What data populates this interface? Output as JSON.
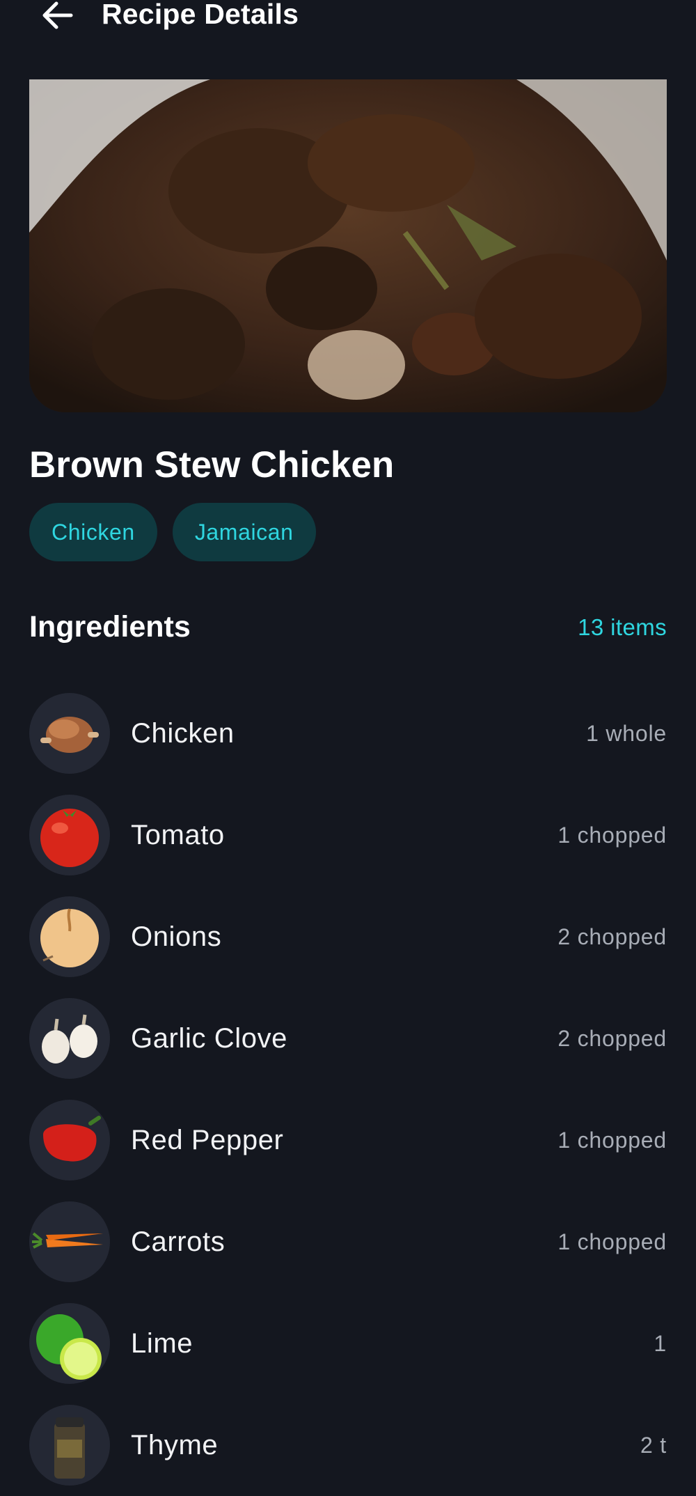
{
  "header": {
    "title": "Recipe Details",
    "back_icon": "arrow-left-icon"
  },
  "recipe": {
    "title": "Brown Stew Chicken",
    "tags": [
      "Chicken",
      "Jamaican"
    ]
  },
  "ingredients": {
    "title": "Ingredients",
    "count": "13 items",
    "items": [
      {
        "name": "Chicken",
        "qty": "1 whole",
        "icon": "roast-chicken-icon"
      },
      {
        "name": "Tomato",
        "qty": "1 chopped",
        "icon": "tomato-icon"
      },
      {
        "name": "Onions",
        "qty": "2 chopped",
        "icon": "onion-icon"
      },
      {
        "name": "Garlic Clove",
        "qty": "2 chopped",
        "icon": "garlic-icon"
      },
      {
        "name": "Red Pepper",
        "qty": "1 chopped",
        "icon": "red-pepper-icon"
      },
      {
        "name": "Carrots",
        "qty": "1 chopped",
        "icon": "carrot-icon"
      },
      {
        "name": "Lime",
        "qty": "1",
        "icon": "lime-icon"
      },
      {
        "name": "Thyme",
        "qty": "2 t",
        "icon": "thyme-jar-icon"
      }
    ]
  },
  "colors": {
    "background": "#14171f",
    "accent": "#2fd6e0",
    "tag_bg": "#0f3a40"
  }
}
